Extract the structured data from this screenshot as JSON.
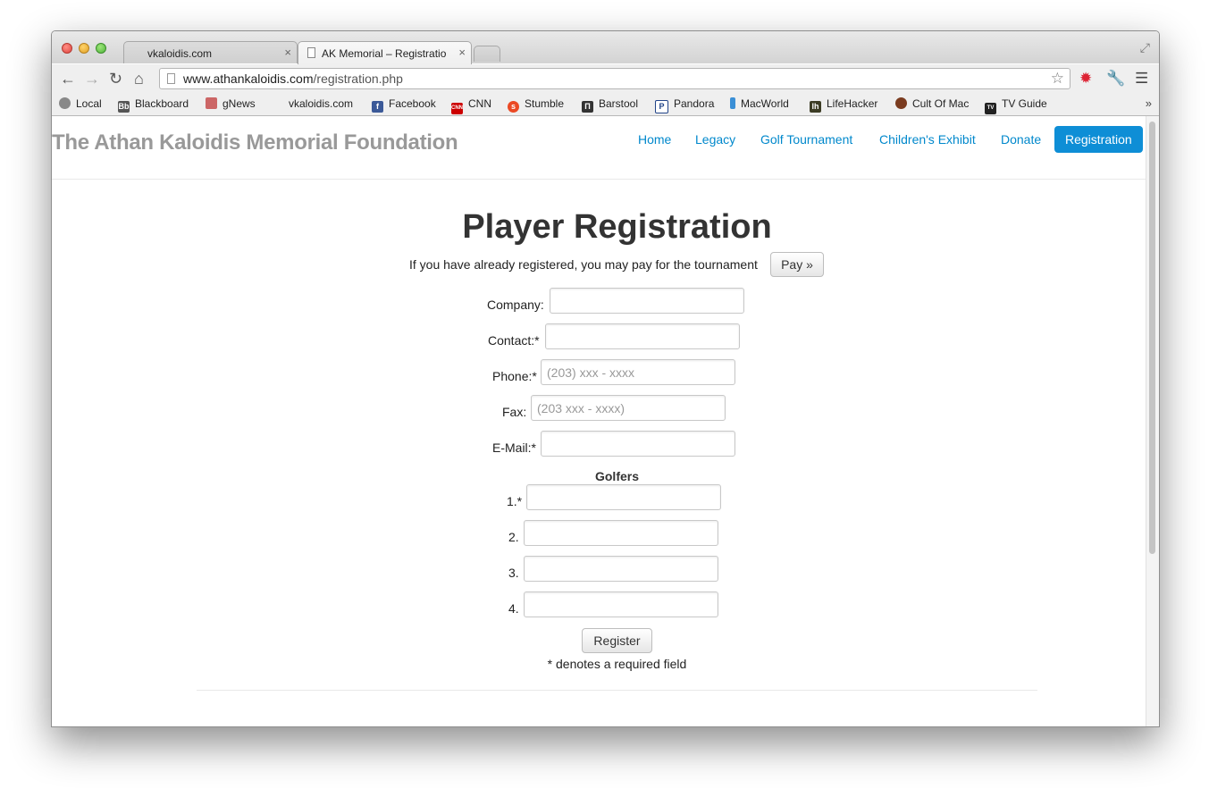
{
  "browser": {
    "tabs": [
      {
        "title": "vkaloidis.com",
        "active": false
      },
      {
        "title": "AK Memorial – Registration",
        "active": true
      }
    ],
    "url_domain": "www.athankaloidis.com",
    "url_path": "/registration.php",
    "bookmarks": [
      {
        "label": "Local",
        "icon": "globe-icon"
      },
      {
        "label": "Blackboard",
        "icon": "blackboard-icon"
      },
      {
        "label": "gNews",
        "icon": "news-icon"
      },
      {
        "label": "vkaloidis.com",
        "icon": "blank-icon"
      },
      {
        "label": "Facebook",
        "icon": "facebook-icon"
      },
      {
        "label": "CNN",
        "icon": "cnn-icon"
      },
      {
        "label": "Stumble",
        "icon": "stumbleupon-icon"
      },
      {
        "label": "Barstool",
        "icon": "barstool-icon"
      },
      {
        "label": "Pandora",
        "icon": "pandora-icon"
      },
      {
        "label": "MacWorld",
        "icon": "macworld-icon"
      },
      {
        "label": "LifeHacker",
        "icon": "lifehacker-icon"
      },
      {
        "label": "Cult Of Mac",
        "icon": "cultofmac-icon"
      },
      {
        "label": "TV Guide",
        "icon": "tvguide-icon"
      }
    ],
    "bookmarks_more": "»"
  },
  "site": {
    "brand": "The Athan Kaloidis Memorial Foundation",
    "nav": [
      "Home",
      "Legacy",
      "Golf Tournament",
      "Children's Exhibit",
      "Donate",
      "Registration"
    ],
    "active_nav": "Registration",
    "accent_color": "#0e8ed6",
    "link_color": "#0088cc"
  },
  "form": {
    "title": "Player Registration",
    "intro": "If you have already registered, you may pay for the tournament",
    "pay_button": "Pay »",
    "fields": {
      "company_label": "Company:",
      "contact_label": "Contact:*",
      "phone_label": "Phone:*",
      "phone_placeholder": "(203) xxx - xxxx",
      "fax_label": "Fax:",
      "fax_placeholder": "(203 xxx - xxxx)",
      "email_label": "E-Mail:*"
    },
    "golfers_heading": "Golfers",
    "golfer_labels": [
      "1.*",
      "2.",
      "3.",
      "4."
    ],
    "register_button": "Register",
    "required_note": "* denotes a required field"
  }
}
